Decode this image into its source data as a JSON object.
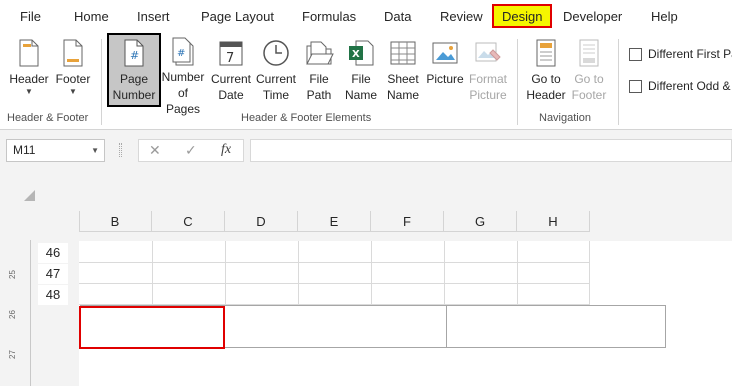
{
  "tabs": [
    "File",
    "Home",
    "Insert",
    "Page Layout",
    "Formulas",
    "Data",
    "Review",
    "Design",
    "Developer",
    "Help"
  ],
  "ribbon": {
    "buttons": {
      "header": {
        "line1": "Header",
        "icon": "header-icon"
      },
      "footer": {
        "line1": "Footer",
        "icon": "footer-icon"
      },
      "page_number": {
        "line1": "Page",
        "line2": "Number",
        "icon": "page-number-icon"
      },
      "number_of_pages": {
        "line1": "Number",
        "line2": "of Pages",
        "icon": "number-of-pages-icon"
      },
      "current_date": {
        "line1": "Current",
        "line2": "Date",
        "icon": "calendar-icon"
      },
      "current_time": {
        "line1": "Current",
        "line2": "Time",
        "icon": "clock-icon"
      },
      "file_path": {
        "line1": "File",
        "line2": "Path",
        "icon": "folder-icon"
      },
      "file_name": {
        "line1": "File",
        "line2": "Name",
        "icon": "excel-file-icon"
      },
      "sheet_name": {
        "line1": "Sheet",
        "line2": "Name",
        "icon": "sheet-icon"
      },
      "picture": {
        "line1": "Picture",
        "icon": "picture-icon"
      },
      "format_picture": {
        "line1": "Format",
        "line2": "Picture",
        "icon": "format-picture-icon"
      },
      "go_to_header": {
        "line1": "Go to",
        "line2": "Header",
        "icon": "go-to-header-icon"
      },
      "go_to_footer": {
        "line1": "Go to",
        "line2": "Footer",
        "icon": "go-to-footer-icon"
      }
    },
    "groups": {
      "header_footer": "Header & Footer",
      "elements": "Header & Footer Elements",
      "navigation": "Navigation"
    },
    "options": {
      "different_first": "Different First Pa",
      "different_odd": "Different Odd &"
    }
  },
  "formula_bar": {
    "name_box": "M11",
    "cancel": "✕",
    "enter": "✓",
    "fx": "fx",
    "value": ""
  },
  "sheet": {
    "columns": [
      "B",
      "C",
      "D",
      "E",
      "F",
      "G",
      "H"
    ],
    "rows": [
      "46",
      "47",
      "48"
    ],
    "ruler_ticks": [
      "25",
      "26",
      "27"
    ]
  },
  "colors": {
    "design_tab_bg": "#f5f500",
    "highlight_border": "#e00000",
    "selected_button_bg": "#c6c6c6"
  }
}
